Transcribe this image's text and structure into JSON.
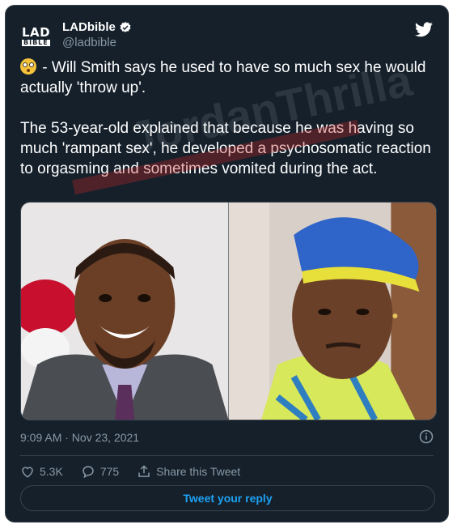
{
  "author": {
    "display_name": "LADbible",
    "handle": "@ladbible",
    "avatar_line1": "LAD",
    "avatar_line2": "BIBLE",
    "verified": true
  },
  "tweet": {
    "paragraph1": " - Will Smith says he used to have so much sex he would actually 'throw up'.",
    "paragraph2": "The 53-year-old explained that because he was having so much 'rampant sex', he developed a psychosomatic reaction to orgasming and sometimes vomited during the act.",
    "emoji": "flushed-face-emoji",
    "watermark": "JordanThrilla"
  },
  "meta": {
    "timestamp": "9:09 AM · Nov 23, 2021"
  },
  "actions": {
    "likes": "5.3K",
    "replies": "775",
    "share_label": "Share this Tweet"
  },
  "reply_button": {
    "label": "Tweet your reply"
  },
  "colors": {
    "background": "#15202b",
    "text": "#ffffff",
    "muted": "#8899a6",
    "accent": "#1da1f2",
    "border": "#38444d"
  }
}
